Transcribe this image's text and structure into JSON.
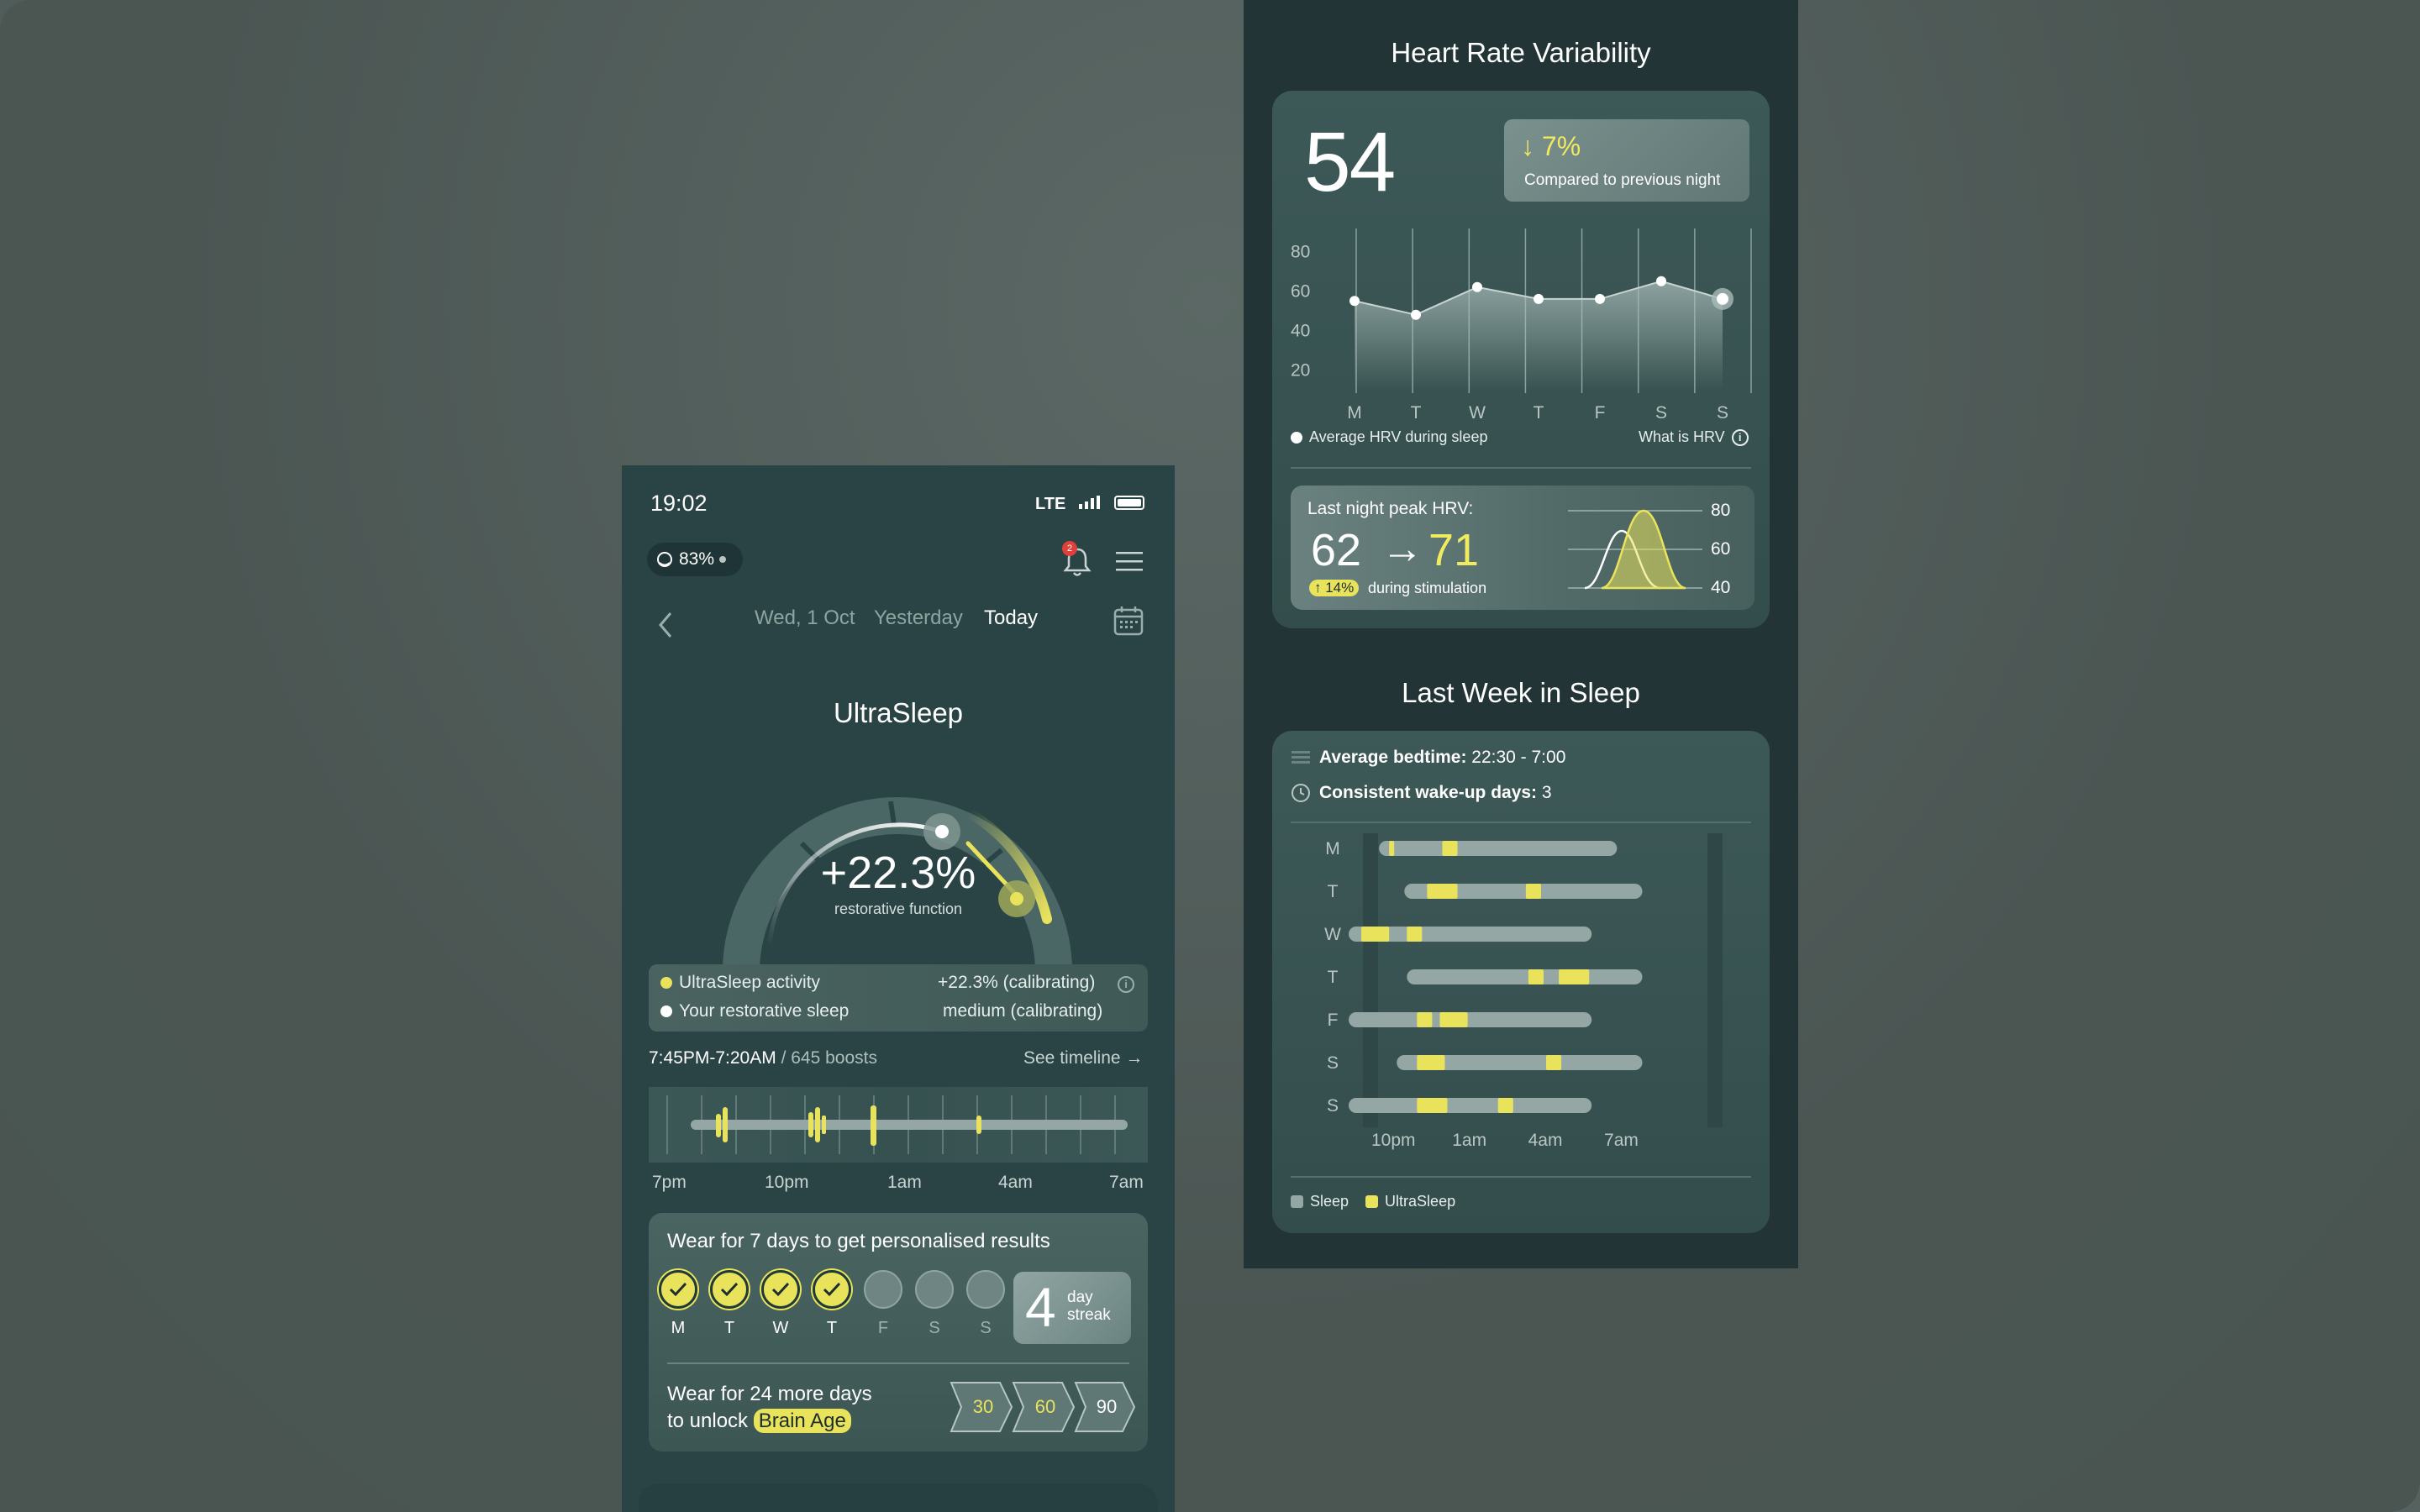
{
  "phone": {
    "status": {
      "time": "19:02",
      "network": "LTE"
    },
    "battery_pill": {
      "value": "83%"
    },
    "notification_count": "2",
    "date_nav": {
      "date": "Wed, 1 Oct",
      "yesterday": "Yesterday",
      "today": "Today"
    },
    "gauge": {
      "title": "UltraSleep",
      "value": "+22.3%",
      "subtitle": "restorative function"
    },
    "legend": {
      "activity_label": "UltraSleep activity",
      "activity_value": "+22.3% (calibrating)",
      "restorative_label": "Your restorative sleep",
      "restorative_value": "medium (calibrating)"
    },
    "boosts": {
      "window": "7:45PM-7:20AM",
      "count": " / 645 boosts",
      "see_timeline": "See timeline →"
    },
    "timeline_labels": [
      "7pm",
      "10pm",
      "1am",
      "4am",
      "7am"
    ],
    "wear": {
      "title": "Wear for 7 days to get personalised results",
      "days": [
        {
          "letter": "M",
          "done": true
        },
        {
          "letter": "T",
          "done": true
        },
        {
          "letter": "W",
          "done": true
        },
        {
          "letter": "T",
          "done": true
        },
        {
          "letter": "F",
          "done": false
        },
        {
          "letter": "S",
          "done": false
        },
        {
          "letter": "S",
          "done": false
        }
      ],
      "streak_number": "4",
      "streak_line1": "day",
      "streak_line2": "streak",
      "unlock_line1": "Wear for 24 more days",
      "unlock_line2": "to unlock ",
      "unlock_badge": "Brain Age",
      "milestones": [
        "30",
        "60",
        "90"
      ]
    }
  },
  "hrv": {
    "title": "Heart Rate Variability",
    "value": "54",
    "compare_pct": "↓ 7%",
    "compare_sub": "Compared to previous night",
    "legend": "Average HRV during sleep",
    "what_is": "What is HRV",
    "peak": {
      "title": "Last night peak HRV:",
      "from": "62",
      "arrow": "→",
      "to": "71",
      "badge": "↑ 14%",
      "sub": "during stimulation",
      "y_labels": [
        "80",
        "60",
        "40"
      ]
    }
  },
  "sleep_week": {
    "title": "Last Week in Sleep",
    "bedtime_label": "Average bedtime:",
    "bedtime_value": " 22:30 - 7:00",
    "wakeup_label": "Consistent wake-up days:",
    "wakeup_value": " 3",
    "legend_sleep": "Sleep",
    "legend_ultrasleep": "UltraSleep"
  },
  "chart_data": [
    {
      "type": "area",
      "categories": [
        "M",
        "T",
        "W",
        "T",
        "F",
        "S",
        "S"
      ],
      "values": [
        55,
        48,
        62,
        56,
        56,
        65,
        56
      ],
      "ylim": [
        10,
        90
      ],
      "y_ticks": [
        "80",
        "60",
        "40",
        "20"
      ],
      "legend": "Average HRV during sleep"
    },
    {
      "type": "bar",
      "categories": [
        "M",
        "T",
        "W",
        "T",
        "F",
        "S",
        "S"
      ],
      "x_ticks": [
        "10pm",
        "1am",
        "4am",
        "7am"
      ],
      "x_range_hours": [
        20,
        35
      ],
      "sleep": [
        [
          21.2,
          30.0
        ],
        [
          22.2,
          31.0
        ],
        [
          20.0,
          29.0
        ],
        [
          22.3,
          31.0
        ],
        [
          20.0,
          29.0
        ],
        [
          21.9,
          31.0
        ],
        [
          20.0,
          29.0
        ]
      ],
      "ultrasleep": [
        [
          [
            21.3,
            21.5
          ],
          [
            23.4,
            24.0
          ]
        ],
        [
          [
            22.8,
            24.0
          ],
          [
            26.7,
            27.3
          ]
        ],
        [
          [
            20.2,
            21.3
          ],
          [
            22.0,
            22.6
          ]
        ],
        [
          [
            26.8,
            27.4
          ],
          [
            28.0,
            29.2
          ]
        ],
        [
          [
            22.4,
            23.0
          ],
          [
            23.3,
            24.4
          ]
        ],
        [
          [
            22.4,
            23.5
          ],
          [
            27.5,
            28.1
          ]
        ],
        [
          [
            22.4,
            23.6
          ],
          [
            25.6,
            26.2
          ]
        ]
      ],
      "legend": [
        "Sleep",
        "UltraSleep"
      ]
    }
  ]
}
